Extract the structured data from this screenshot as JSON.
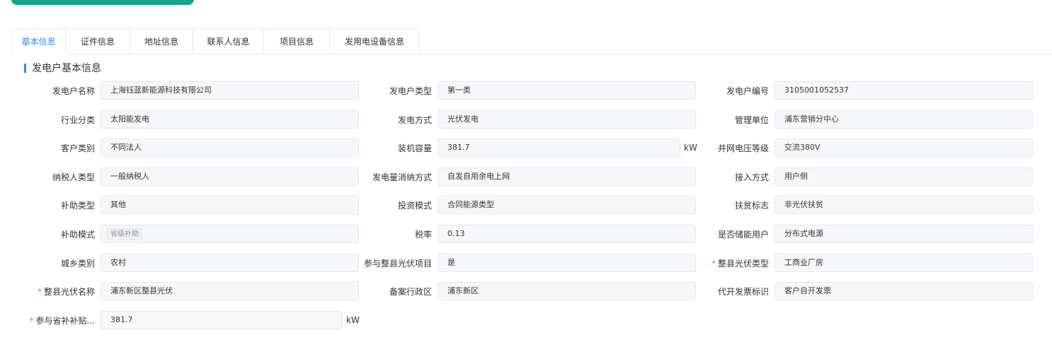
{
  "tabs": [
    "基本信息",
    "证件信息",
    "地址信息",
    "联系人信息",
    "项目信息",
    "发用电设备信息"
  ],
  "section_title": "发电户基本信息",
  "rows": [
    [
      {
        "label": "发电户名称",
        "value": "上海钰蓝新能源科技有限公司"
      },
      {
        "label": "发电户类型",
        "value": "第一类"
      },
      {
        "label": "发电户编号",
        "value": "3105001052537"
      }
    ],
    [
      {
        "label": "行业分类",
        "value": "太阳能发电"
      },
      {
        "label": "发电方式",
        "value": "光伏发电"
      },
      {
        "label": "管理单位",
        "value": "浦东营销分中心"
      }
    ],
    [
      {
        "label": "客户类别",
        "value": "不同法人"
      },
      {
        "label": "装机容量",
        "value": "381.7",
        "unit": "kW"
      },
      {
        "label": "并网电压等级",
        "value": "交流380V"
      }
    ],
    [
      {
        "label": "纳税人类型",
        "value": "一般纳税人"
      },
      {
        "label": "发电量消纳方式",
        "value": "自发自用余电上网"
      },
      {
        "label": "接入方式",
        "value": "用户侧"
      }
    ],
    [
      {
        "label": "补助类型",
        "value": "其他"
      },
      {
        "label": "投资模式",
        "value": "合同能源类型"
      },
      {
        "label": "扶贫标志",
        "value": "非光伏扶贫"
      }
    ],
    [
      {
        "label": "补助模式",
        "tag": "省级补助"
      },
      {
        "label": "税率",
        "value": "0.13"
      },
      {
        "label": "是否储能用户",
        "value": "分布式电源"
      }
    ],
    [
      {
        "label": "城乡类别",
        "value": "农村"
      },
      {
        "label": "参与整县光伏项目",
        "value": "是"
      },
      {
        "label": "整县光伏类型",
        "value": "工商业厂房",
        "required": true
      }
    ],
    [
      {
        "label": "整县光伏名称",
        "value": "浦东新区整县光伏",
        "required": true
      },
      {
        "label": "备案行政区",
        "value": "浦东新区"
      },
      {
        "label": "代开发票标识",
        "value": "客户自开发票"
      }
    ],
    [
      {
        "label": "参与省补补贴...",
        "value": "381.7",
        "unit": "kW",
        "required": true
      }
    ]
  ],
  "required_mark": "*"
}
